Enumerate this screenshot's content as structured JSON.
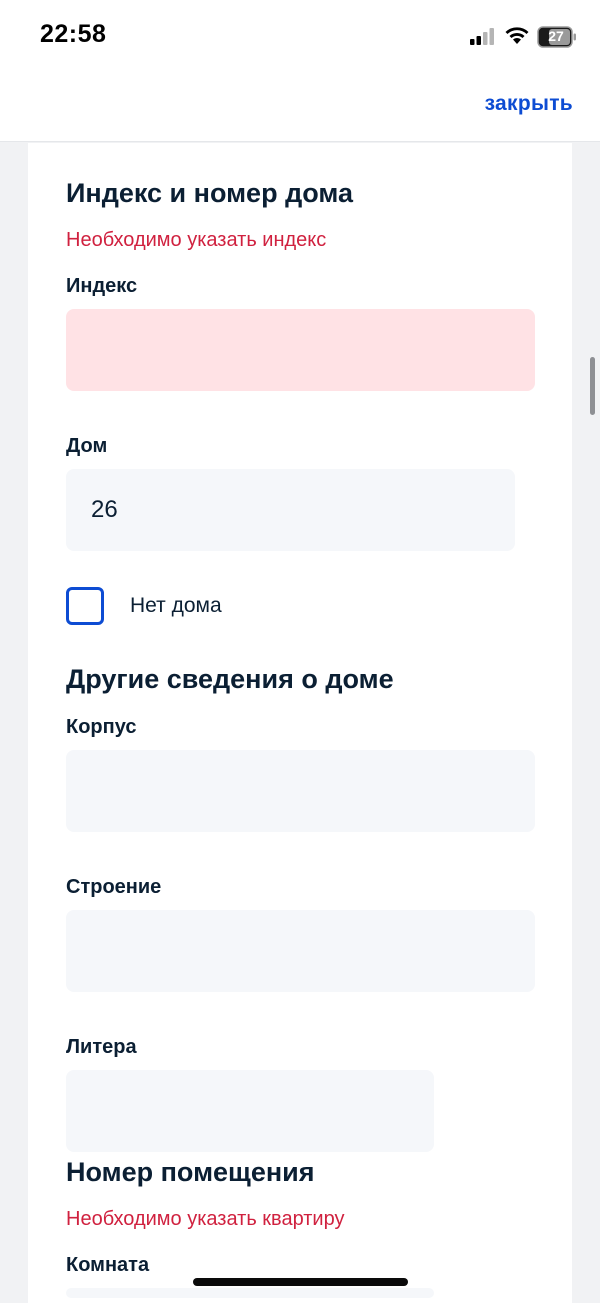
{
  "status_bar": {
    "time": "22:58",
    "battery": "27",
    "icons": [
      "signal-icon",
      "wifi-icon",
      "battery-icon"
    ]
  },
  "nav": {
    "close_label": "закрыть"
  },
  "colors": {
    "accent": "#0d4cd3",
    "error": "#d0213f",
    "error_field_bg": "#ffe2e5",
    "field_bg": "#f5f7fa",
    "text": "#0b1f33"
  },
  "section_index": {
    "title": "Индекс и номер дома",
    "error": "Необходимо указать индекс",
    "index_label": "Индекс",
    "index_value": "",
    "house_label": "Дом",
    "house_value": "26",
    "no_house_label": "Нет дома",
    "no_house_checked": false
  },
  "section_other": {
    "title": "Другие сведения о доме",
    "building_label": "Корпус",
    "building_value": "",
    "structure_label": "Строение",
    "structure_value": "",
    "letter_label": "Литера",
    "letter_value": ""
  },
  "section_room": {
    "title": "Номер помещения",
    "error": "Необходимо указать квартиру",
    "room_label": "Комната",
    "room_value": ""
  }
}
